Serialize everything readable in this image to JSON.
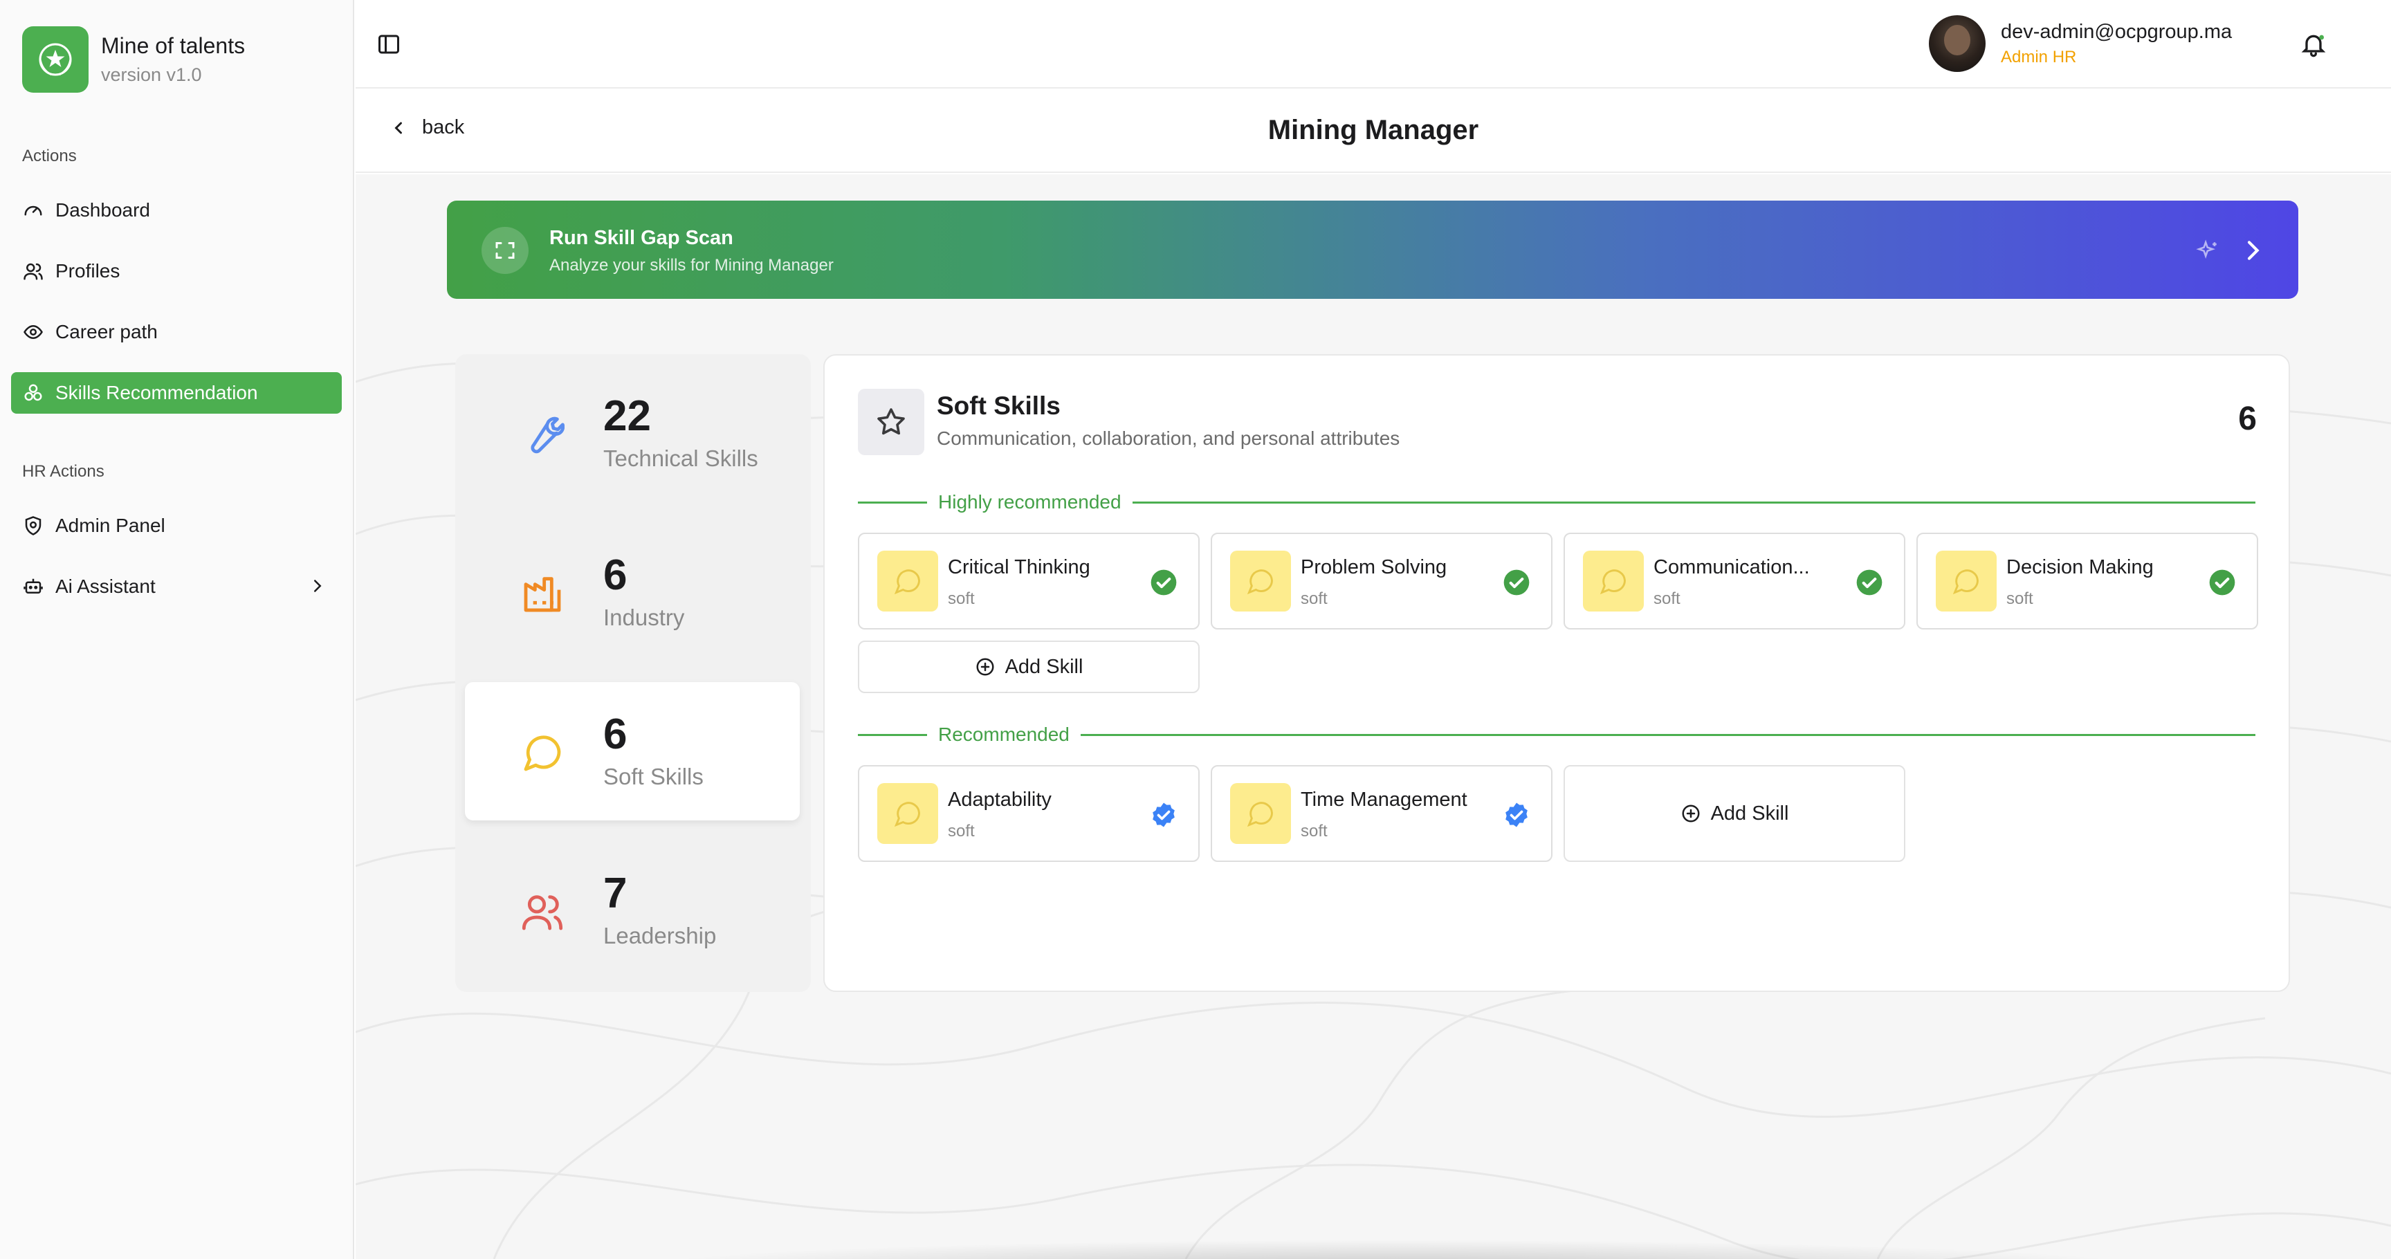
{
  "app": {
    "name": "Mine of talents",
    "version": "version v1.0"
  },
  "sidebar": {
    "actions_label": "Actions",
    "items": [
      {
        "label": "Dashboard",
        "icon": "gauge-icon"
      },
      {
        "label": "Profiles",
        "icon": "users-icon"
      },
      {
        "label": "Career path",
        "icon": "eye-icon"
      },
      {
        "label": "Skills Recommendation",
        "icon": "circles-icon",
        "active": true
      }
    ],
    "hr_label": "HR Actions",
    "hr_items": [
      {
        "label": "Admin Panel",
        "icon": "shield-icon"
      },
      {
        "label": "Ai Assistant",
        "icon": "bot-icon"
      }
    ]
  },
  "user": {
    "email": "dev-admin@ocpgroup.ma",
    "role": "Admin HR"
  },
  "header": {
    "back_label": "back",
    "title": "Mining Manager"
  },
  "scan": {
    "title": "Run Skill Gap Scan",
    "subtitle": "Analyze your skills for Mining Manager"
  },
  "categories": [
    {
      "count": "22",
      "label": "Technical Skills",
      "icon": "wrench-icon",
      "color": "#5b8def"
    },
    {
      "count": "6",
      "label": "Industry",
      "icon": "factory-icon",
      "color": "#f08a24"
    },
    {
      "count": "6",
      "label": "Soft Skills",
      "icon": "message-circle-icon",
      "color": "#f2c230",
      "active": true
    },
    {
      "count": "7",
      "label": "Leadership",
      "icon": "users-icon",
      "color": "#e0605a"
    }
  ],
  "panel": {
    "title": "Soft Skills",
    "description": "Communication, collaboration, and personal attributes",
    "count": "6",
    "highly_label": "Highly recommended",
    "recommended_label": "Recommended",
    "add_skill_label": "Add Skill",
    "highly": [
      {
        "name": "Critical Thinking",
        "type": "soft"
      },
      {
        "name": "Problem Solving",
        "type": "soft"
      },
      {
        "name": "Communication...",
        "type": "soft"
      },
      {
        "name": "Decision Making",
        "type": "soft"
      }
    ],
    "recommended": [
      {
        "name": "Adaptability",
        "type": "soft"
      },
      {
        "name": "Time Management",
        "type": "soft"
      }
    ]
  },
  "colors": {
    "brand": "#4caf50",
    "role": "#f2a100",
    "check_green": "#43a047",
    "check_blue": "#3b82f6",
    "skill_icon_bg": "#fdec8e"
  }
}
